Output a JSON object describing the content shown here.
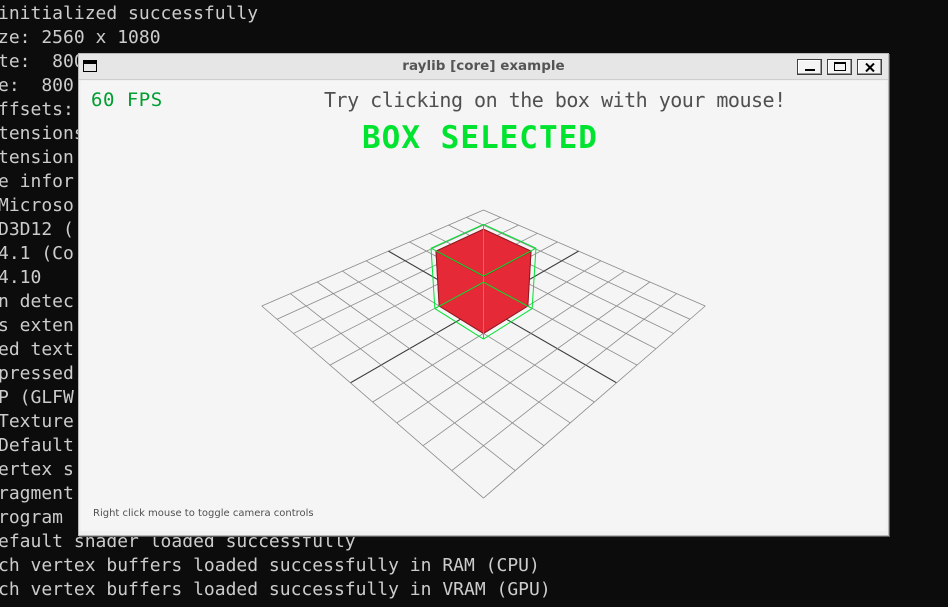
{
  "console": {
    "lines": [
      "initialized successfully",
      "ze: 2560 x 1080",
      "te:  800",
      "e:  800",
      "ffsets:",
      "tensions",
      "tension",
      "e infor",
      "Microso",
      "D3D12 (",
      "4.1 (Co",
      "4.10",
      "n detec",
      "s exten",
      "ed text",
      "pressed",
      "P (GLFW",
      "Texture",
      "Default",
      "ertex s",
      "ragment",
      "rogram",
      "efault shader loaded successfully",
      "ch vertex buffers loaded successfully in RAM (CPU)",
      "ch vertex buffers loaded successfully in VRAM (GPU)"
    ]
  },
  "window": {
    "title": "raylib [core] example",
    "buttons": {
      "minimize": "minimize",
      "maximize": "maximize",
      "close": "close"
    }
  },
  "scene": {
    "fps_text": "60 FPS",
    "instruction": "Try clicking on the box with your mouse!",
    "status": "BOX SELECTED",
    "hint": "Right click mouse to toggle camera controls",
    "grid_slices": 10,
    "cube_selected": true
  },
  "colors": {
    "background": "#f5f5f5",
    "grid": "#8a8a8a",
    "grid_axis": "#3a3a3a",
    "cube_fill": "#e62937",
    "cube_wire": "#8b1a20",
    "selection_box": "#00e430",
    "fps": "#009e2f",
    "status": "#00e430",
    "text": "#505050",
    "console_text": "#cccccc",
    "console_bg": "#0c0c0c"
  },
  "icons": {
    "app": "window-icon",
    "close": "close-icon",
    "minimize": "minimize-icon",
    "maximize": "maximize-icon"
  }
}
